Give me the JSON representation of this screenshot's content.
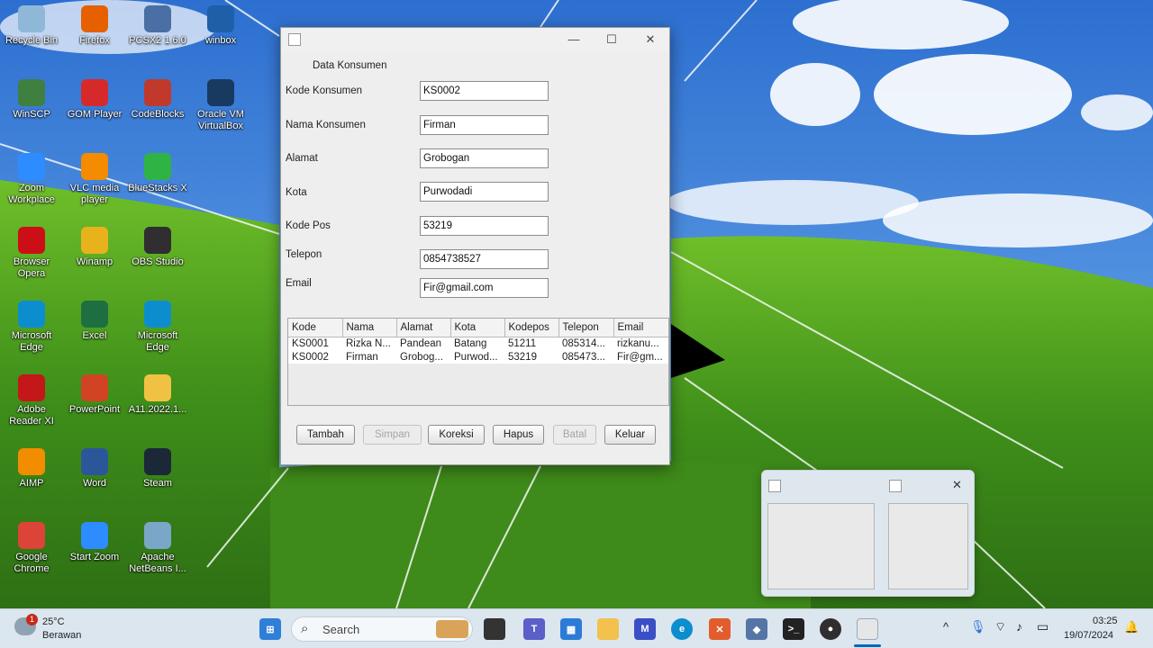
{
  "desktop": {
    "icons": [
      {
        "label": "Recycle Bin",
        "icon": "recycle-bin-icon",
        "color": "#8fb8d8"
      },
      {
        "label": "Firefox",
        "icon": "firefox-icon",
        "color": "#e66000"
      },
      {
        "label": "PCSX2 1.6.0",
        "icon": "pcsx2-icon",
        "color": "#4a6fa5"
      },
      {
        "label": "winbox",
        "icon": "winbox-icon",
        "color": "#1f5fa8"
      },
      {
        "label": "WinSCP",
        "icon": "winscp-icon",
        "color": "#3f7f3f"
      },
      {
        "label": "GOM Player",
        "icon": "gom-player-icon",
        "color": "#d62a2a"
      },
      {
        "label": "CodeBlocks",
        "icon": "codeblocks-icon",
        "color": "#c0392b"
      },
      {
        "label": "Oracle VM VirtualBox",
        "icon": "virtualbox-icon",
        "color": "#183a61"
      },
      {
        "label": "Zoom Workplace",
        "icon": "zoom-icon",
        "color": "#2d8cff"
      },
      {
        "label": "VLC media player",
        "icon": "vlc-icon",
        "color": "#f48b00"
      },
      {
        "label": "BlueStacks X",
        "icon": "bluestacks-icon",
        "color": "#2fb344"
      },
      {
        "label": "Browser Opera",
        "icon": "opera-icon",
        "color": "#cc0f16"
      },
      {
        "label": "Winamp",
        "icon": "winamp-icon",
        "color": "#e8b21c"
      },
      {
        "label": "OBS Studio",
        "icon": "obs-icon",
        "color": "#302e31"
      },
      {
        "label": "Microsoft Edge",
        "icon": "edge-icon",
        "color": "#0c8ece"
      },
      {
        "label": "Excel",
        "icon": "excel-icon",
        "color": "#1d6f42"
      },
      {
        "label": "Microsoft Edge",
        "icon": "edge-icon",
        "color": "#0c8ece"
      },
      {
        "label": "Adobe Reader XI",
        "icon": "adobe-reader-icon",
        "color": "#c4171a"
      },
      {
        "label": "PowerPoint",
        "icon": "powerpoint-icon",
        "color": "#d04423"
      },
      {
        "label": "A11.2022.1...",
        "icon": "folder-icon",
        "color": "#f0c243"
      },
      {
        "label": "AIMP",
        "icon": "aimp-icon",
        "color": "#f28c00"
      },
      {
        "label": "Word",
        "icon": "word-icon",
        "color": "#2b579a"
      },
      {
        "label": "Steam",
        "icon": "steam-icon",
        "color": "#1b2838"
      },
      {
        "label": "Google Chrome",
        "icon": "chrome-icon",
        "color": "#db4437"
      },
      {
        "label": "Start Zoom",
        "icon": "zoom-icon",
        "color": "#2d8cff"
      },
      {
        "label": "Apache NetBeans I...",
        "icon": "netbeans-icon",
        "color": "#7aa7c7"
      }
    ]
  },
  "window": {
    "title": "",
    "minimize_symbol": "—",
    "maximize_symbol": "☐",
    "close_symbol": "✕",
    "form_title": "Data Konsumen",
    "fields": [
      {
        "label": "Kode Konsumen",
        "value": "KS0002"
      },
      {
        "label": "Nama Konsumen",
        "value": "Firman"
      },
      {
        "label": "Alamat",
        "value": "Grobogan"
      },
      {
        "label": "Kota",
        "value": "Purwodadi"
      },
      {
        "label": "Kode Pos",
        "value": "53219"
      },
      {
        "label": "Telepon",
        "value": "0854738527"
      },
      {
        "label": "Email",
        "value": "Fir@gmail.com"
      }
    ],
    "table": {
      "columns": [
        "Kode",
        "Nama",
        "Alamat",
        "Kota",
        "Kodepos",
        "Telepon",
        "Email"
      ],
      "rows": [
        [
          "KS0001",
          "Rizka N...",
          "Pandean",
          "Batang",
          "51211",
          "085314...",
          "rizkanu..."
        ],
        [
          "KS0002",
          "Firman",
          "Grobog...",
          "Purwod...",
          "53219",
          "085473...",
          "Fir@gm..."
        ]
      ]
    },
    "buttons": [
      {
        "label": "Tambah",
        "enabled": true
      },
      {
        "label": "Simpan",
        "enabled": false
      },
      {
        "label": "Koreksi",
        "enabled": true
      },
      {
        "label": "Hapus",
        "enabled": true
      },
      {
        "label": "Batal",
        "enabled": false
      },
      {
        "label": "Keluar",
        "enabled": true
      }
    ]
  },
  "preview": {
    "close_symbol": "✕"
  },
  "taskbar": {
    "weather_temp": "25°C",
    "weather_desc": "Berawan",
    "weather_badge": "1",
    "search_placeholder": "Search",
    "time": "03:25",
    "date": "19/07/2024",
    "apps": [
      "start-icon",
      "search-icon",
      "task-view-icon",
      "teams-icon",
      "store-icon",
      "file-explorer-icon",
      "visual-studio-icon",
      "edge-icon",
      "xampp-icon",
      "virtualbox-icon",
      "terminal-icon",
      "obs-icon",
      "java-icon"
    ]
  },
  "colors": {
    "taskbar_bg": "#dbe6ef",
    "window_bg": "#eeeeee",
    "accent": "#0067c0"
  }
}
